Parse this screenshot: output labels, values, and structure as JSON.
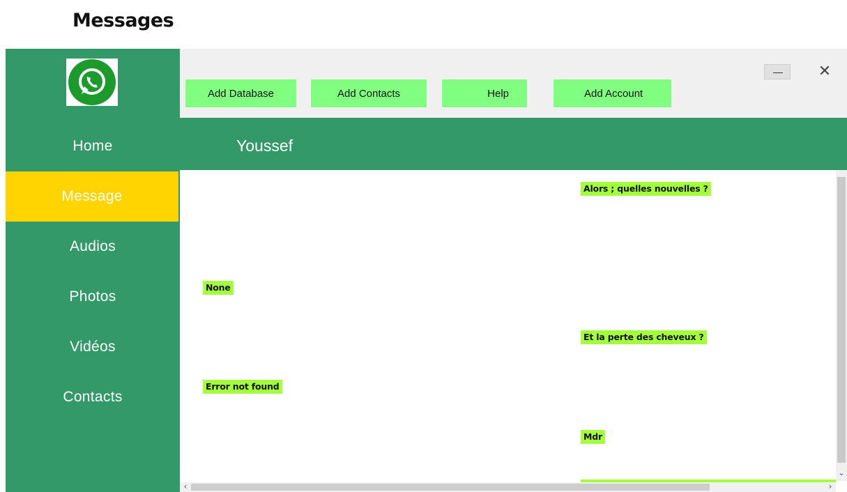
{
  "page": {
    "title": "Messages"
  },
  "sidebar": {
    "logo_icon": "whatsapp-icon",
    "items": [
      {
        "label": "Home",
        "active": false
      },
      {
        "label": "Message",
        "active": true
      },
      {
        "label": "Audios",
        "active": false
      },
      {
        "label": "Photos",
        "active": false
      },
      {
        "label": "Vidéos",
        "active": false
      },
      {
        "label": "Contacts",
        "active": false
      }
    ]
  },
  "toolbar": {
    "buttons": [
      {
        "label": "Add Database"
      },
      {
        "label": "Add Contacts"
      },
      {
        "label": "Help"
      },
      {
        "label": "Add Account"
      }
    ],
    "minimize_icon": "minimize-icon",
    "close_symbol": "✕"
  },
  "chat": {
    "contact_name": "Youssef",
    "messages": [
      {
        "text": "Alors ; quelles nouvelles ?",
        "side": "right"
      },
      {
        "text": "None",
        "side": "left"
      },
      {
        "text": "Et la perte des cheveux ?",
        "side": "right"
      },
      {
        "text": "Error not found",
        "side": "left"
      },
      {
        "text": "Mdr",
        "side": "right"
      }
    ]
  },
  "scrollbars": {
    "down_arrow": "⌄",
    "left_arrow": "‹",
    "right_arrow": "›"
  },
  "colors": {
    "primary_green": "#349968",
    "active_yellow": "#ffd400",
    "button_green": "#80ff80",
    "bubble_green": "#a4ff3c",
    "toolbar_gray": "#f0f0f0"
  }
}
